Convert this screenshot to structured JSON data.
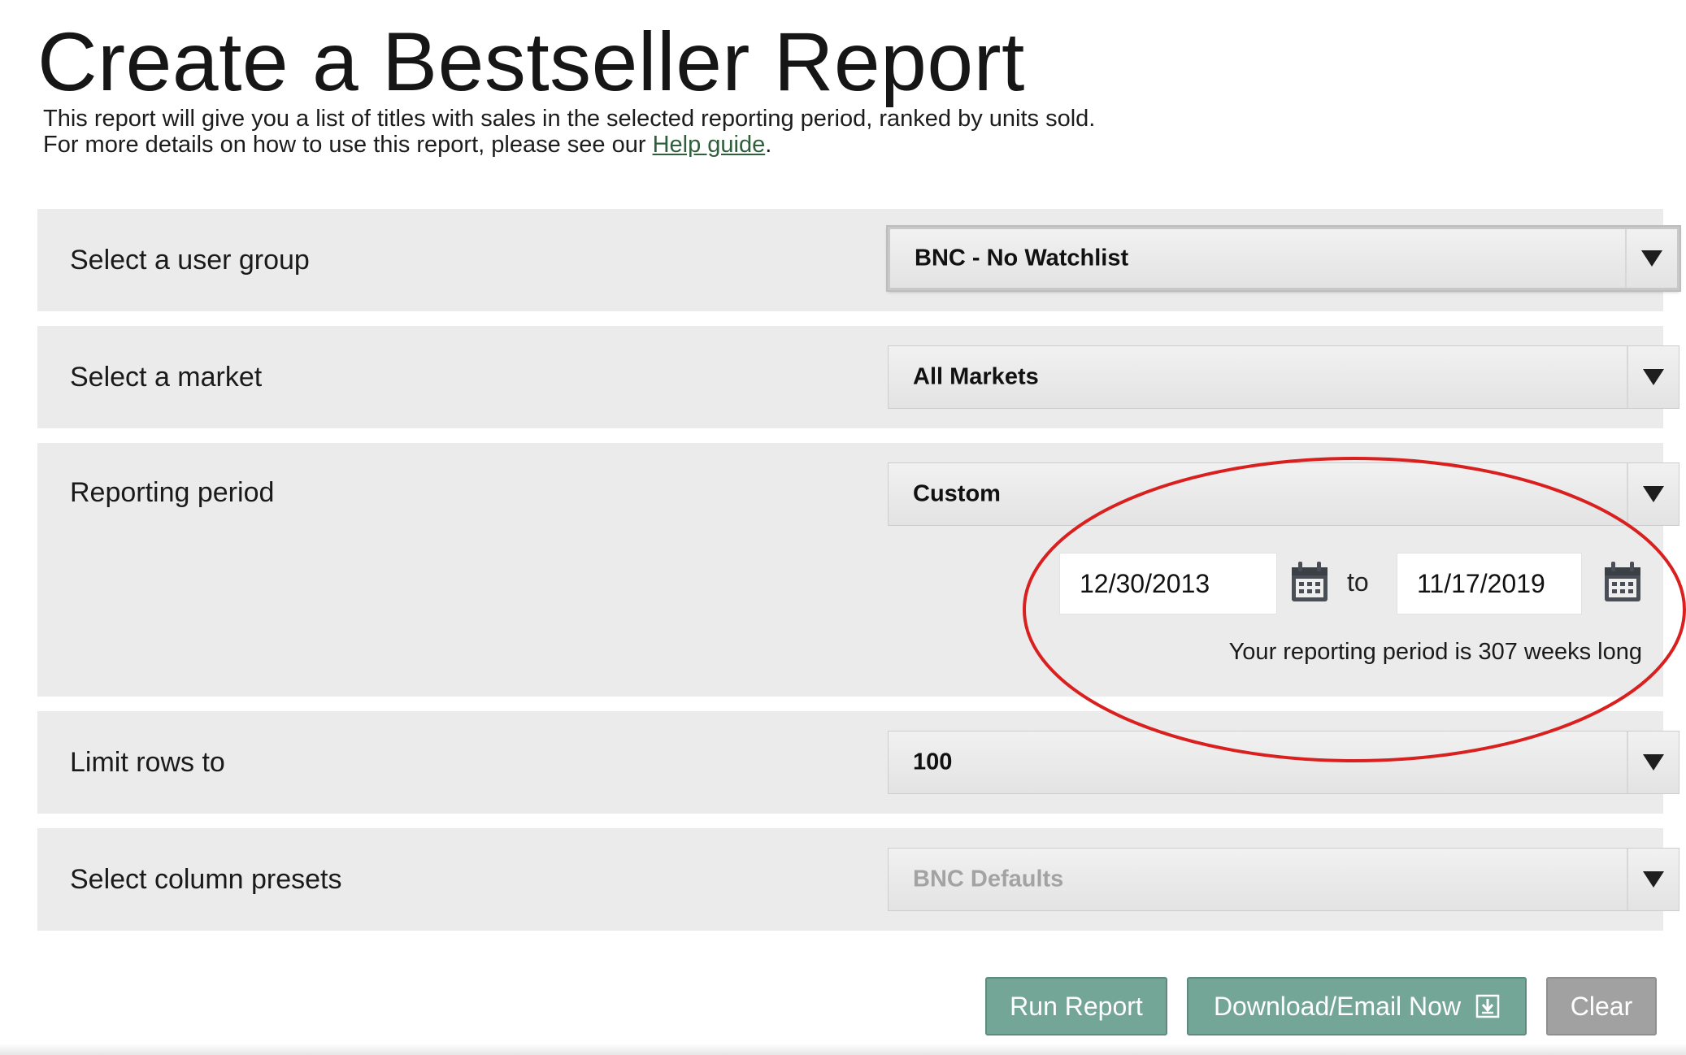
{
  "page": {
    "title": "Create a Bestseller Report",
    "intro_line1": "This report will give you a list of titles with sales in the selected reporting period, ranked by units sold.",
    "intro_line2_prefix": "For more details on how to use this report, please see our ",
    "help_link": "Help guide",
    "intro_line2_suffix": "."
  },
  "form": {
    "user_group": {
      "label": "Select a user group",
      "value": "BNC - No Watchlist"
    },
    "market": {
      "label": "Select a market",
      "value": "All Markets"
    },
    "period": {
      "label": "Reporting period",
      "value": "Custom",
      "from_date": "12/30/2013",
      "to_label": "to",
      "to_date": "11/17/2019",
      "note": "Your reporting period is 307 weeks long"
    },
    "limit_rows": {
      "label": "Limit rows to",
      "value": "100"
    },
    "column_presets": {
      "label": "Select column presets",
      "value": "BNC Defaults"
    }
  },
  "buttons": {
    "run": "Run Report",
    "download": "Download/Email Now",
    "clear": "Clear"
  },
  "icons": {
    "dropdown": "chevron-down-icon",
    "calendar": "calendar-icon",
    "download": "download-icon"
  },
  "colors": {
    "accent_green": "#74a697",
    "link_green": "#2f5e3c",
    "annotation_red": "#d9201f",
    "clear_gray": "#a1a1a1"
  }
}
